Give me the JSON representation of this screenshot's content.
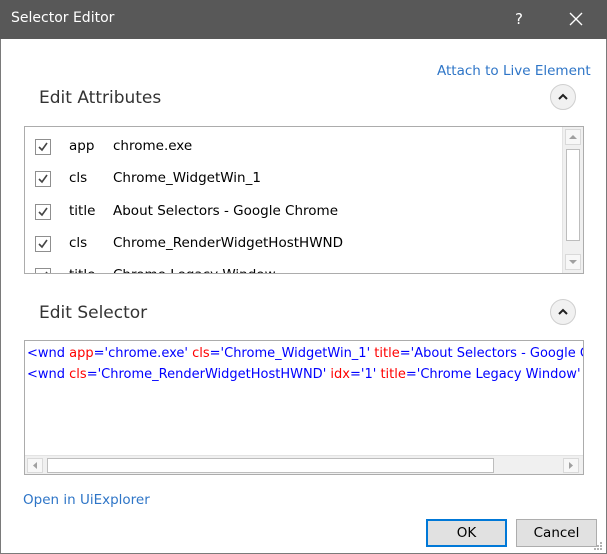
{
  "window": {
    "title": "Selector Editor",
    "help_label": "?"
  },
  "attach_link": "Attach to Live Element",
  "edit_attributes": {
    "title": "Edit Attributes",
    "rows": [
      {
        "key": "app",
        "value": "chrome.exe",
        "checked": true
      },
      {
        "key": "cls",
        "value": "Chrome_WidgetWin_1",
        "checked": true
      },
      {
        "key": "title",
        "value": "About Selectors - Google Chrome",
        "checked": true
      },
      {
        "key": "cls",
        "value": "Chrome_RenderWidgetHostHWND",
        "checked": true
      },
      {
        "key": "title",
        "value": "Chrome Legacy Window",
        "checked": true
      }
    ]
  },
  "edit_selector": {
    "title": "Edit Selector",
    "lines": [
      [
        {
          "text": "<wnd ",
          "kind": "tag"
        },
        {
          "text": "app",
          "kind": "attr"
        },
        {
          "text": "=",
          "kind": "tag"
        },
        {
          "text": "'chrome.exe'",
          "kind": "val"
        },
        {
          "text": " ",
          "kind": "tag"
        },
        {
          "text": "cls",
          "kind": "attr"
        },
        {
          "text": "=",
          "kind": "tag"
        },
        {
          "text": "'Chrome_WidgetWin_1'",
          "kind": "val"
        },
        {
          "text": " ",
          "kind": "tag"
        },
        {
          "text": "title",
          "kind": "attr"
        },
        {
          "text": "=",
          "kind": "tag"
        },
        {
          "text": "'About Selectors - Google Chrome'",
          "kind": "val"
        },
        {
          "text": " />",
          "kind": "tag"
        }
      ],
      [
        {
          "text": "<wnd ",
          "kind": "tag"
        },
        {
          "text": "cls",
          "kind": "attr"
        },
        {
          "text": "=",
          "kind": "tag"
        },
        {
          "text": "'Chrome_RenderWidgetHostHWND'",
          "kind": "val"
        },
        {
          "text": " ",
          "kind": "tag"
        },
        {
          "text": "idx",
          "kind": "attr"
        },
        {
          "text": "=",
          "kind": "tag"
        },
        {
          "text": "'1'",
          "kind": "val"
        },
        {
          "text": " ",
          "kind": "tag"
        },
        {
          "text": "title",
          "kind": "attr"
        },
        {
          "text": "=",
          "kind": "tag"
        },
        {
          "text": "'Chrome Legacy Window'",
          "kind": "val"
        },
        {
          "text": " />",
          "kind": "tag"
        }
      ]
    ]
  },
  "uiexplorer_link": "Open in UiExplorer",
  "buttons": {
    "ok": "OK",
    "cancel": "Cancel"
  },
  "colors": {
    "titlebar": "#585858",
    "link": "#2e75c7",
    "selector_tag": "#0000ff",
    "selector_attr": "#ff0000",
    "default_button_border": "#0078d7"
  }
}
